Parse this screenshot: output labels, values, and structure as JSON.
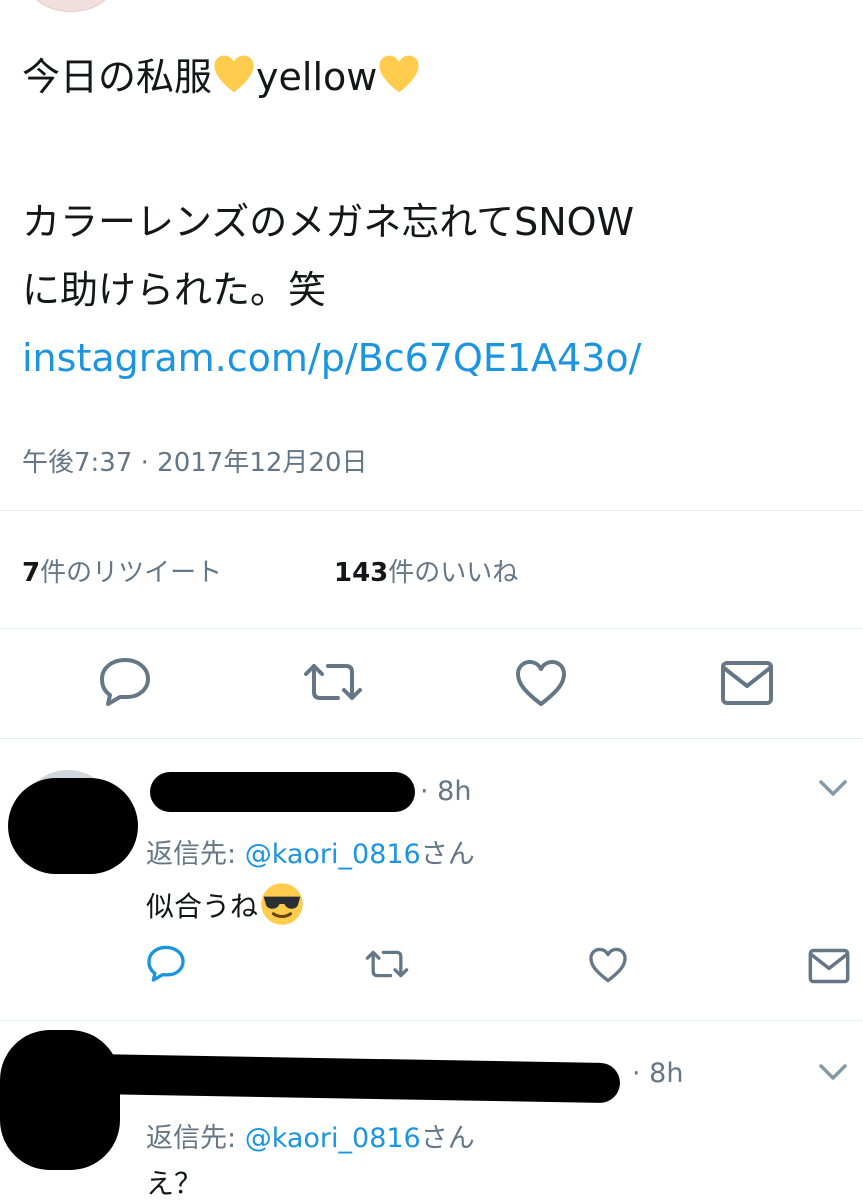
{
  "tweet": {
    "line1_a": "今日の私服",
    "line1_b": "yellow",
    "line2": "カラーレンズのメガネ忘れてSNOW",
    "line3": "に助けられた。笑",
    "link": "instagram.com/p/Bc67QE1A43o/",
    "timestamp": "午後7:37 · 2017年12月20日",
    "retweets_count": "7",
    "retweets_label": "件のリツイート",
    "likes_count": "143",
    "likes_label": "件のいいね"
  },
  "actions": {
    "icons": [
      "reply-icon",
      "retweet-icon",
      "like-icon",
      "message-icon"
    ],
    "color": "#657786"
  },
  "replies": [
    {
      "time": "· 8h",
      "reply_to_prefix": "返信先: ",
      "reply_to_mention": "@kaori_0816",
      "reply_to_suffix": "さん",
      "text": "似合うね"
    },
    {
      "time": "· 8h",
      "reply_to_prefix": "返信先: ",
      "reply_to_mention": "@kaori_0816",
      "reply_to_suffix": "さん",
      "text": "え？"
    }
  ],
  "colors": {
    "link": "#1b95e0",
    "secondary_text": "#657786",
    "divider": "#e6ecf0",
    "heart_emoji": "#ffcc4d"
  }
}
